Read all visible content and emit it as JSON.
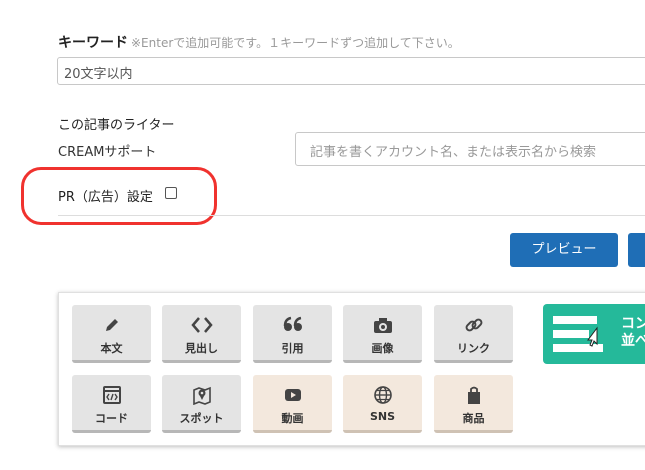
{
  "keyword": {
    "label": "キーワード",
    "note": "※Enterで追加可能です。１キーワードずつ追加して下さい。",
    "value": "20文字以内"
  },
  "writer": {
    "title": "この記事のライター",
    "name": "CREAMサポート",
    "search_placeholder": "記事を書くアカウント名、または表示名から検索"
  },
  "pr": {
    "label": "PR（広告）設定",
    "checked": false
  },
  "actions": {
    "preview_label": "プレビュー"
  },
  "toolbar": {
    "tools": [
      {
        "label": "本文",
        "icon": "pencil-icon"
      },
      {
        "label": "見出し",
        "icon": "angle-brackets-icon"
      },
      {
        "label": "引用",
        "icon": "quote-icon"
      },
      {
        "label": "画像",
        "icon": "camera-icon"
      },
      {
        "label": "リンク",
        "icon": "link-icon"
      },
      {
        "label": "コード",
        "icon": "code-icon"
      },
      {
        "label": "スポット",
        "icon": "map-pin-icon"
      },
      {
        "label": "動画",
        "icon": "youtube-icon"
      },
      {
        "label": "SNS",
        "icon": "globe-icon"
      },
      {
        "label": "商品",
        "icon": "shopping-bag-icon"
      }
    ],
    "reorder_label": "コン\n並べ",
    "accent_color": "#25b99a",
    "primary_color": "#1f6eb6",
    "highlight_color": "#f0322e"
  }
}
